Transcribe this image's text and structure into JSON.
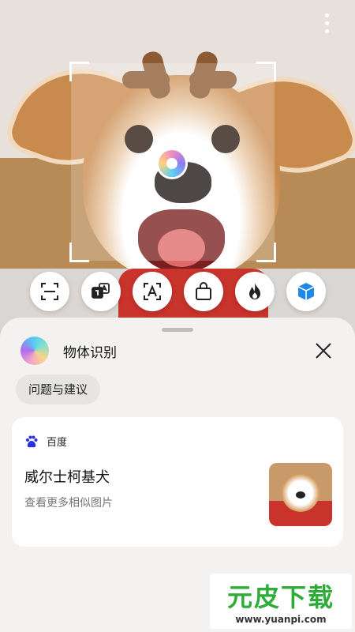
{
  "camera": {
    "more_icon": "more-vertical-icon",
    "focus_icon": "focus-dot-icon"
  },
  "toolbar": {
    "items": [
      {
        "name": "scan",
        "icon": "scan-icon"
      },
      {
        "name": "translate",
        "icon": "translate-icon"
      },
      {
        "name": "text-recognition",
        "icon": "text-recognition-icon"
      },
      {
        "name": "shopping",
        "icon": "shopping-bag-icon"
      },
      {
        "name": "calories",
        "icon": "flame-icon"
      },
      {
        "name": "object-recognition",
        "icon": "cube-icon",
        "active": true
      }
    ]
  },
  "sheet": {
    "title": "物体识别",
    "close_icon": "close-icon",
    "chip_label": "问题与建议",
    "result": {
      "source": "百度",
      "name": "威尔士柯基犬",
      "more_label": "查看更多相似图片"
    }
  },
  "watermark": {
    "main": "元皮下载",
    "url": "www.yuanpi.com"
  },
  "colors": {
    "accent_blue": "#1e88e5",
    "baidu_blue": "#2932e1",
    "watermark_green": "#2eac3a"
  }
}
